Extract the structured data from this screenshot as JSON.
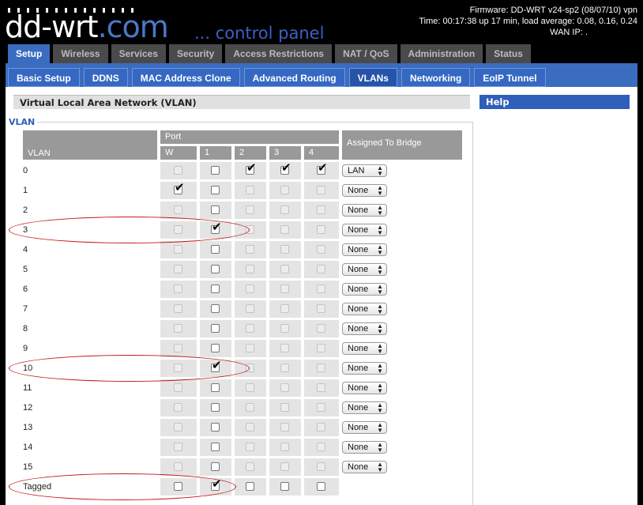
{
  "header": {
    "logo_main": "dd-wrt",
    "logo_suffix": ".com",
    "subtitle": "... control panel",
    "firmware": "Firmware: DD-WRT v24-sp2 (08/07/10) vpn",
    "time": "Time: 00:17:38 up 17 min, load average: 0.08, 0.16, 0.24",
    "wan_ip": "WAN IP: ."
  },
  "main_tabs": [
    "Setup",
    "Wireless",
    "Services",
    "Security",
    "Access Restrictions",
    "NAT / QoS",
    "Administration",
    "Status"
  ],
  "sub_tabs": [
    "Basic Setup",
    "DDNS",
    "MAC Address Clone",
    "Advanced Routing",
    "VLANs",
    "Networking",
    "EoIP Tunnel"
  ],
  "section": {
    "title": "Virtual Local Area Network (VLAN)",
    "legend": "VLAN"
  },
  "help": {
    "title": "Help"
  },
  "table": {
    "vlan_header": "VLAN",
    "port_header": "Port",
    "assigned_header": "Assigned To Bridge",
    "ports": [
      "W",
      "1",
      "2",
      "3",
      "4"
    ],
    "rows": [
      {
        "label": "0",
        "checks": [
          0,
          0,
          1,
          1,
          1
        ],
        "disabled": [
          1,
          0,
          0,
          0,
          0
        ],
        "bridge": "LAN"
      },
      {
        "label": "1",
        "checks": [
          1,
          0,
          0,
          0,
          0
        ],
        "disabled": [
          0,
          0,
          1,
          1,
          1
        ],
        "bridge": "None"
      },
      {
        "label": "2",
        "checks": [
          0,
          0,
          0,
          0,
          0
        ],
        "disabled": [
          1,
          0,
          1,
          1,
          1
        ],
        "bridge": "None"
      },
      {
        "label": "3",
        "checks": [
          0,
          1,
          0,
          0,
          0
        ],
        "disabled": [
          1,
          0,
          1,
          1,
          1
        ],
        "bridge": "None"
      },
      {
        "label": "4",
        "checks": [
          0,
          0,
          0,
          0,
          0
        ],
        "disabled": [
          1,
          0,
          1,
          1,
          1
        ],
        "bridge": "None"
      },
      {
        "label": "5",
        "checks": [
          0,
          0,
          0,
          0,
          0
        ],
        "disabled": [
          1,
          0,
          1,
          1,
          1
        ],
        "bridge": "None"
      },
      {
        "label": "6",
        "checks": [
          0,
          0,
          0,
          0,
          0
        ],
        "disabled": [
          1,
          0,
          1,
          1,
          1
        ],
        "bridge": "None"
      },
      {
        "label": "7",
        "checks": [
          0,
          0,
          0,
          0,
          0
        ],
        "disabled": [
          1,
          0,
          1,
          1,
          1
        ],
        "bridge": "None"
      },
      {
        "label": "8",
        "checks": [
          0,
          0,
          0,
          0,
          0
        ],
        "disabled": [
          1,
          0,
          1,
          1,
          1
        ],
        "bridge": "None"
      },
      {
        "label": "9",
        "checks": [
          0,
          0,
          0,
          0,
          0
        ],
        "disabled": [
          1,
          0,
          1,
          1,
          1
        ],
        "bridge": "None"
      },
      {
        "label": "10",
        "checks": [
          0,
          1,
          0,
          0,
          0
        ],
        "disabled": [
          1,
          0,
          1,
          1,
          1
        ],
        "bridge": "None"
      },
      {
        "label": "11",
        "checks": [
          0,
          0,
          0,
          0,
          0
        ],
        "disabled": [
          1,
          0,
          1,
          1,
          1
        ],
        "bridge": "None"
      },
      {
        "label": "12",
        "checks": [
          0,
          0,
          0,
          0,
          0
        ],
        "disabled": [
          1,
          0,
          1,
          1,
          1
        ],
        "bridge": "None"
      },
      {
        "label": "13",
        "checks": [
          0,
          0,
          0,
          0,
          0
        ],
        "disabled": [
          1,
          0,
          1,
          1,
          1
        ],
        "bridge": "None"
      },
      {
        "label": "14",
        "checks": [
          0,
          0,
          0,
          0,
          0
        ],
        "disabled": [
          1,
          0,
          1,
          1,
          1
        ],
        "bridge": "None"
      },
      {
        "label": "15",
        "checks": [
          0,
          0,
          0,
          0,
          0
        ],
        "disabled": [
          1,
          0,
          1,
          1,
          1
        ],
        "bridge": "None"
      }
    ],
    "tagged": {
      "label": "Tagged",
      "checks": [
        0,
        1,
        0,
        0,
        0
      ],
      "disabled": [
        0,
        0,
        0,
        0,
        0
      ]
    },
    "highlighted_rows": [
      "3",
      "10",
      "Tagged"
    ]
  },
  "colors": {
    "accent": "#3a6cc0",
    "highlight_oval": "#c41a1a"
  }
}
